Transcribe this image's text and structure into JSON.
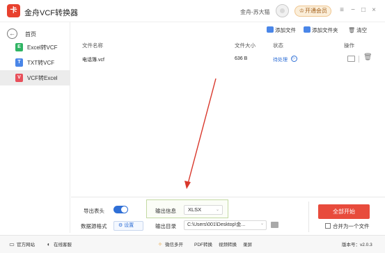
{
  "titlebar": {
    "logo_char": "卡",
    "app_title": "金舟VCF转换器",
    "user_name": "金舟-苏大猫",
    "vip_label": "开通会员",
    "vip_icon": "crown-icon",
    "menu_glyph": "≡",
    "minimize_glyph": "−",
    "maximize_glyph": "□",
    "close_glyph": "×"
  },
  "sidebar": {
    "home_label": "首页",
    "home_glyph": "←",
    "items": [
      {
        "label": "Excel转VCF",
        "badge": "E",
        "color": "#2fb463",
        "active": false
      },
      {
        "label": "TXT转VCF",
        "badge": "T",
        "color": "#4a86e8",
        "active": false
      },
      {
        "label": "VCF转Excel",
        "badge": "V",
        "color": "#e8505b",
        "active": true
      }
    ]
  },
  "toolbar": {
    "add_file": "添加文件",
    "add_folder": "添加文件夹",
    "clear": "清空",
    "clear_glyph": "🗑"
  },
  "table": {
    "headers": {
      "name": "文件名称",
      "size": "文件大小",
      "status": "状态",
      "action": "操作"
    },
    "rows": [
      {
        "name": "电话簿.vcf",
        "size": "636 B",
        "status": "待处理"
      }
    ],
    "status_glyph": "▷",
    "delete_glyph": "🗑"
  },
  "options": {
    "export_header_label": "导出表头",
    "export_header_on": true,
    "data_source_label": "数据源格式",
    "settings_label": "设置",
    "settings_glyph": "⚙",
    "output_info_label": "输出信息",
    "output_format": "XLSX",
    "output_dir_label": "输出目录",
    "output_dir": "C:\\Users\\001\\Desktop\\金...",
    "chevron_glyph": "⌄",
    "start_label": "全部开始",
    "merge_label": "合并为一个文件",
    "merge_checked": false
  },
  "statusbar": {
    "website": "官方网站",
    "support": "在线客服",
    "multi_open": "微信多开",
    "pdf_convert": "PDF转换",
    "video_convert": "视频转换",
    "record": "录屏",
    "version": "版本号：v2.0.3",
    "website_glyph": "▭",
    "support_glyph": "◐",
    "multi_glyph": "✧"
  },
  "colors": {
    "accent": "#2f6fd6",
    "start": "#e84b3c",
    "annotation_arrow": "#d9382c"
  }
}
